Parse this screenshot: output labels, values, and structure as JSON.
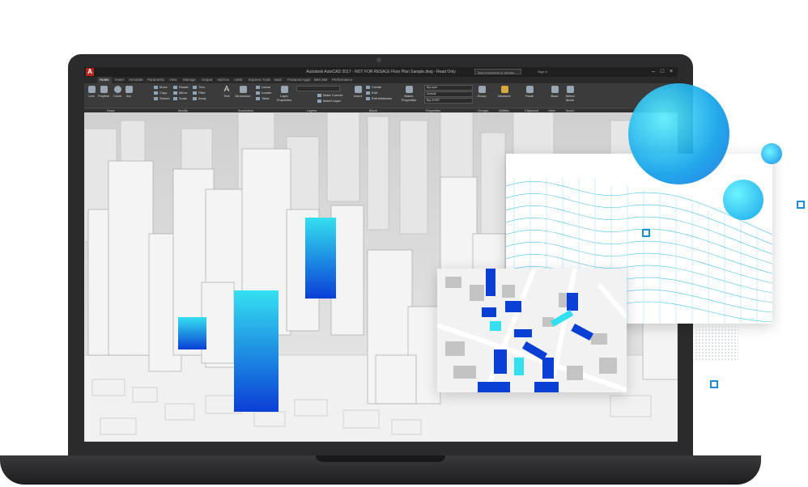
{
  "app": {
    "logo_letter": "A",
    "window_title": "Autodesk AutoCAD 2017 - NOT FOR RESALE   Floor Plan Sample.dwg - Read Only",
    "search_placeholder": "Type a keyword or phrase",
    "user_label": "Sign In"
  },
  "ribbon_tabs": [
    "Home",
    "Insert",
    "Annotate",
    "Parametric",
    "View",
    "Manage",
    "Output",
    "Add-ins",
    "A360",
    "Express Tools",
    "Vault",
    "Featured Apps",
    "BIM 360",
    "Performance"
  ],
  "ribbon": {
    "draw": {
      "line": "Line",
      "polyline": "Polyline",
      "circle": "Circle",
      "arc": "Arc"
    },
    "modify": {
      "move": "Move",
      "rotate": "Rotate",
      "trim": "Trim",
      "copy": "Copy",
      "mirror": "Mirror",
      "fillet": "Fillet",
      "stretch": "Stretch",
      "scale": "Scale",
      "array": "Array"
    },
    "annotation": {
      "text": "Text",
      "dimension": "Dimension",
      "linear": "Linear",
      "leader": "Leader",
      "table": "Table"
    },
    "layers": {
      "layer_properties": "Layer Properties",
      "make_current": "Make Current",
      "match_layer": "Match Layer"
    },
    "block": {
      "insert": "Insert",
      "create": "Create",
      "edit": "Edit",
      "edit_attributes": "Edit Attributes"
    },
    "properties": {
      "match_properties": "Match Properties",
      "bylayer": "ByLayer",
      "default": "Default",
      "bylayer_linetype": "ByLAYER"
    },
    "groups": {
      "group": "Group"
    },
    "utilities": {
      "measure": "Measure"
    },
    "clipboard": {
      "paste": "Paste"
    },
    "view": {
      "base": "Base"
    },
    "touch": {
      "select_mode": "Select Mode"
    },
    "panel_labels": [
      "Draw",
      "Modify",
      "Annotation",
      "Layers",
      "Block",
      "Properties",
      "Groups",
      "Utilities",
      "Clipboard",
      "View",
      "Touch"
    ]
  },
  "colors": {
    "accent_blue": "#0a3fd6",
    "accent_cyan": "#34e0f0",
    "wave": "#2bb8e8",
    "autocad_red": "#b3261e"
  }
}
